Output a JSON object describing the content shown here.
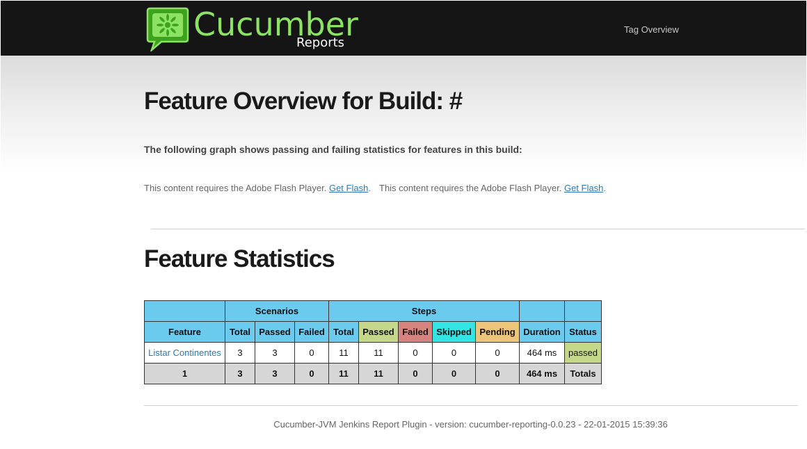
{
  "header": {
    "logo_title": "Cucumber",
    "logo_subtitle": "Reports",
    "nav_tag_overview": "Tag Overview",
    "brand_color": "#8ce363",
    "logo_icon": "cucumber-speech-bubble-icon"
  },
  "main": {
    "title": "Feature Overview for Build: #",
    "lead": "The following graph shows passing and failing statistics for features in this build:",
    "flash_notices": [
      {
        "text": "This content requires the Adobe Flash Player.",
        "link": "Get Flash"
      },
      {
        "text": "This content requires the Adobe Flash Player.",
        "link": "Get Flash"
      }
    ],
    "stats_title": "Feature Statistics"
  },
  "table": {
    "group_headers": {
      "scenarios": "Scenarios",
      "steps": "Steps"
    },
    "columns": {
      "feature": "Feature",
      "sc_total": "Total",
      "sc_passed": "Passed",
      "sc_failed": "Failed",
      "st_total": "Total",
      "st_passed": "Passed",
      "st_failed": "Failed",
      "st_skipped": "Skipped",
      "st_pending": "Pending",
      "duration": "Duration",
      "status": "Status"
    },
    "rows": [
      {
        "feature": "Listar Continentes",
        "sc_total": "3",
        "sc_passed": "3",
        "sc_failed": "0",
        "st_total": "11",
        "st_passed": "11",
        "st_failed": "0",
        "st_skipped": "0",
        "st_pending": "0",
        "duration": "464 ms",
        "status": "passed"
      }
    ],
    "totals": {
      "feature": "1",
      "sc_total": "3",
      "sc_passed": "3",
      "sc_failed": "0",
      "st_total": "11",
      "st_passed": "11",
      "st_failed": "0",
      "st_skipped": "0",
      "st_pending": "0",
      "duration": "464 ms",
      "status": "Totals"
    },
    "colors": {
      "header": "#6bcbef",
      "passed": "#c5d88a",
      "failed": "#d6827f",
      "skipped": "#33e4e4",
      "pending": "#ecc47a",
      "totals": "#d6d6d6"
    }
  },
  "footer": {
    "text": "Cucumber-JVM Jenkins Report Plugin - version: cucumber-reporting-0.0.23 - 22-01-2015 15:39:36"
  }
}
